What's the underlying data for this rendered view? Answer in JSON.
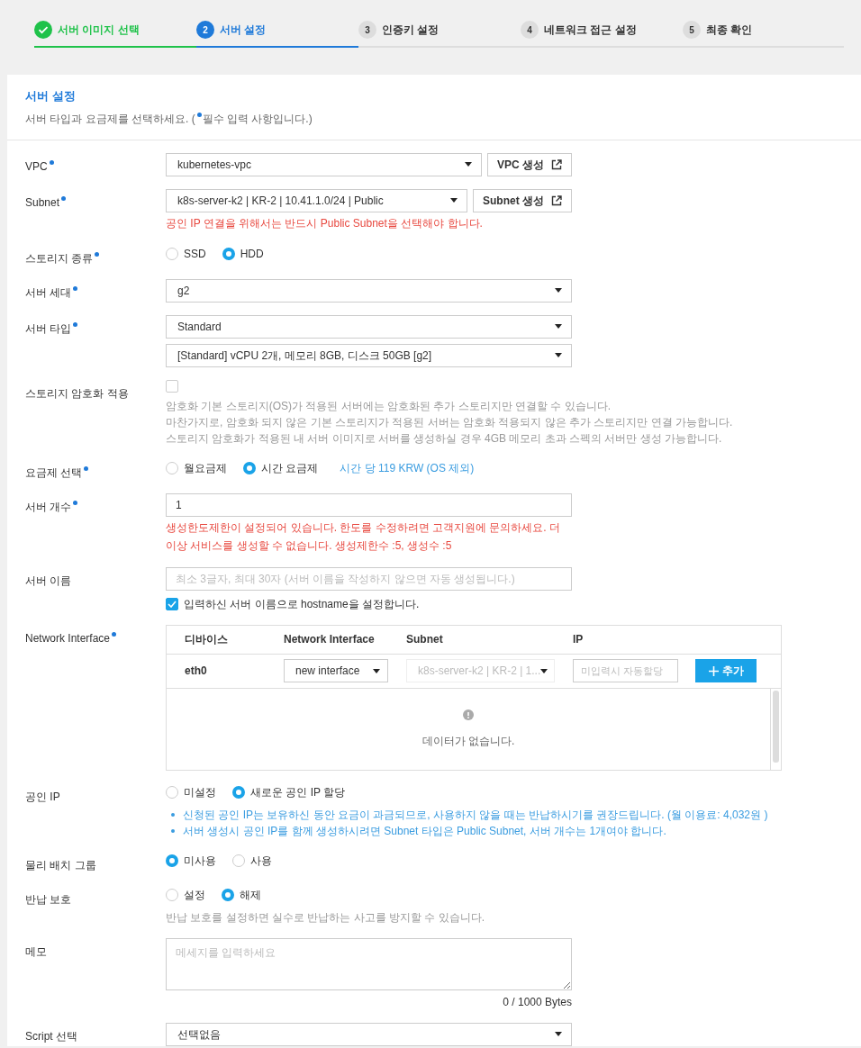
{
  "steps": [
    {
      "label": "서버 이미지 선택",
      "completed": true,
      "selected": false
    },
    {
      "number": "2",
      "label": "서버 설정",
      "completed": false,
      "selected": true
    },
    {
      "number": "3",
      "label": "인증키 설정",
      "completed": false,
      "selected": false
    },
    {
      "number": "4",
      "label": "네트워크 접근 설정",
      "completed": false,
      "selected": false
    },
    {
      "number": "5",
      "label": "최종 확인",
      "completed": false,
      "selected": false
    }
  ],
  "section": {
    "title": "서버 설정",
    "description": [
      "서버 타입과 요금제를 선택하세요. (",
      "필수 입력 사항입니다.)"
    ]
  },
  "fields": [
    {
      "label": "VPC",
      "required": true,
      "lines": [
        [
          {
            "kind": "select",
            "value": "kubernetes-vpc"
          },
          {
            "kind": "button",
            "label": "VPC 생성"
          }
        ]
      ]
    },
    {
      "label": "Subnet",
      "required": true,
      "lines": [
        [
          {
            "kind": "select",
            "value": "k8s-server-k2 | KR-2 | 10.41.1.0/24 | Public"
          },
          {
            "kind": "button",
            "label": "Subnet 생성"
          }
        ],
        [
          {
            "kind": "error",
            "text": "공인 IP 연결을 위해서는 반드시 Public Subnet을 선택해야 합니다."
          }
        ]
      ]
    },
    {
      "label": "스토리지 종류",
      "required": true,
      "lines": [
        [
          {
            "kind": "radios",
            "options": [
              {
                "label": "SSD",
                "selected": false
              },
              {
                "label": "HDD",
                "selected": true
              }
            ]
          }
        ]
      ]
    },
    {
      "label": "서버 세대",
      "required": true,
      "lines": [
        [
          {
            "kind": "select",
            "value": "g2"
          }
        ]
      ]
    },
    {
      "label": "서버 타입",
      "required": true,
      "lines": [
        [
          {
            "kind": "select",
            "value": "Standard"
          }
        ],
        [
          {
            "kind": "select",
            "value": "[Standard] vCPU 2개, 메모리 8GB, 디스크 50GB [g2]"
          }
        ]
      ]
    },
    {
      "label": "스토리지 암호화 적용",
      "required": false,
      "lines": [
        [
          {
            "kind": "checkbox",
            "checked": false
          }
        ],
        [
          {
            "kind": "note",
            "text": "암호화 기본 스토리지(OS)가 적용된 서버에는 암호화된 추가 스토리지만 연결할 수 있습니다."
          }
        ],
        [
          {
            "kind": "note",
            "text": "마찬가지로, 암호화 되지 않은 기본 스토리지가 적용된 서버는 암호화 적용되지 않은 추가 스토리지만 연결 가능합니다."
          }
        ],
        [
          {
            "kind": "note",
            "text": "스토리지 암호화가 적용된 내 서버 이미지로 서버를 생성하실 경우 4GB 메모리 초과 스펙의 서버만 생성 가능합니다."
          }
        ]
      ]
    },
    {
      "label": "요금제 선택",
      "required": true,
      "lines": [
        [
          {
            "kind": "radios",
            "options": [
              {
                "label": "월요금제",
                "selected": false
              },
              {
                "label": "시간 요금제",
                "selected": true
              }
            ]
          },
          {
            "kind": "info",
            "text": "시간 당 119 KRW (OS 제외)"
          }
        ]
      ]
    },
    {
      "label": "서버 개수",
      "required": true,
      "lines": [
        [
          {
            "kind": "input",
            "value": "1"
          }
        ],
        [
          {
            "kind": "error",
            "text": "생성한도제한이 설정되어 있습니다. 한도를 수정하려면 고객지원에 문의하세요. 더 이상 서비스를 생성할 수 없습니다. 생성제한수 :5, 생성수 :5"
          }
        ]
      ]
    },
    {
      "label": "서버 이름",
      "required": false,
      "lines": [
        [
          {
            "kind": "input",
            "placeholder": "최소 3글자, 최대 30자 (서버 이름을 작성하지 않으면 자동 생성됩니다.)"
          }
        ],
        [
          {
            "kind": "checkbox",
            "checked": true,
            "label": "입력하신 서버 이름으로 hostname을 설정합니다."
          }
        ]
      ]
    },
    {
      "label": "Network Interface",
      "required": true,
      "lines": [
        [
          {
            "kind": "table",
            "columns": [
              "디바이스",
              "Network Interface",
              "Subnet",
              "IP"
            ],
            "row": {
              "device": "eth0",
              "interface": "new interface",
              "subnet": "k8s-server-k2 | KR-2 | 1...",
              "subnet_disabled": true,
              "ip_placeholder": "미입력시 자동할당",
              "button": "추가"
            },
            "empty": "데이터가 없습니다."
          }
        ]
      ]
    },
    {
      "label": "공인 IP",
      "required": false,
      "lines": [
        [
          {
            "kind": "radios",
            "options": [
              {
                "label": "미설정",
                "selected": false
              },
              {
                "label": "새로운 공인 IP 할당",
                "selected": true
              }
            ]
          }
        ],
        [
          {
            "kind": "bullet",
            "text": "신청된 공인 IP는 보유하신 동안 요금이 과금되므로, 사용하지 않을 때는 반납하시기를 권장드립니다. (월 이용료: 4,032원 )"
          }
        ],
        [
          {
            "kind": "bullet",
            "text": "서버 생성시 공인 IP를 함께 생성하시려면 Subnet 타입은 Public Subnet, 서버 개수는 1개여야 합니다."
          }
        ]
      ]
    },
    {
      "label": "물리 배치 그룹",
      "required": false,
      "lines": [
        [
          {
            "kind": "radios",
            "options": [
              {
                "label": "미사용",
                "selected": true
              },
              {
                "label": "사용",
                "selected": false
              }
            ]
          }
        ]
      ]
    },
    {
      "label": "반납 보호",
      "required": false,
      "lines": [
        [
          {
            "kind": "radios",
            "options": [
              {
                "label": "설정",
                "selected": false
              },
              {
                "label": "해제",
                "selected": true
              }
            ]
          }
        ],
        [
          {
            "kind": "note",
            "text": "반납 보호를 설정하면 실수로 반납하는 사고를 방지할 수 있습니다."
          }
        ]
      ]
    },
    {
      "label": "메모",
      "required": false,
      "lines": [
        [
          {
            "kind": "textarea",
            "placeholder": "메세지를 입력하세요"
          }
        ],
        [
          {
            "kind": "counter",
            "text": "0 / 1000 Bytes"
          }
        ]
      ]
    },
    {
      "label": "Script 선택",
      "required": false,
      "lines": [
        [
          {
            "kind": "select",
            "value": "선택없음"
          }
        ]
      ]
    }
  ]
}
